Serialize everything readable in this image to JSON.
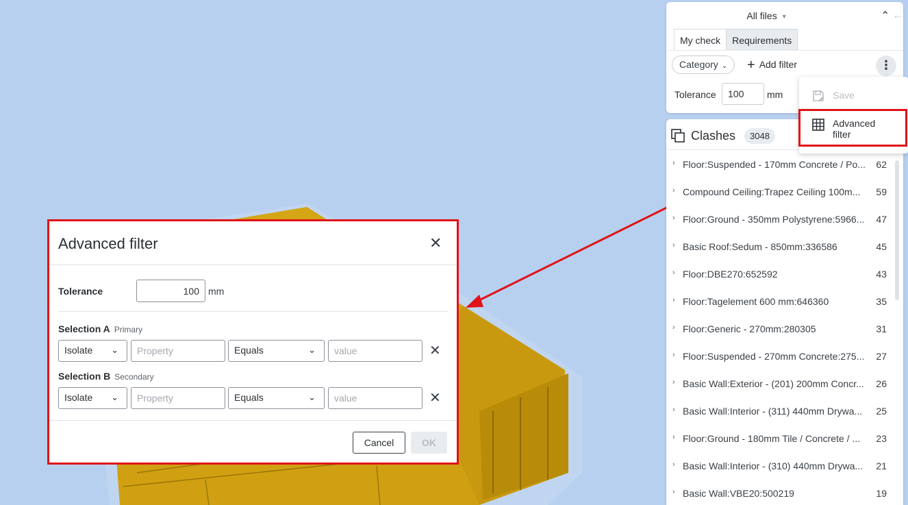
{
  "files_panel": {
    "scope_label": "All files",
    "tabs": [
      {
        "label": "My check",
        "active": true
      },
      {
        "label": "Requirements",
        "active": false
      }
    ],
    "category_label": "Category",
    "add_filter_label": "Add filter",
    "tolerance_label": "Tolerance",
    "tolerance_value": "100",
    "tolerance_unit": "mm"
  },
  "menu": {
    "save_label": "Save",
    "advanced_filter_label": "Advanced filter"
  },
  "clashes": {
    "title": "Clashes",
    "count": "3048",
    "rows": [
      {
        "name": "Floor:Suspended - 170mm Concrete / Po...",
        "count": "62"
      },
      {
        "name": "Compound Ceiling:Trapez Ceiling 100m...",
        "count": "59"
      },
      {
        "name": "Floor:Ground - 350mm Polystyrene:5966...",
        "count": "47"
      },
      {
        "name": "Basic Roof:Sedum - 850mm:336586",
        "count": "45"
      },
      {
        "name": "Floor:DBE270:652592",
        "count": "43"
      },
      {
        "name": "Floor:Tagelement 600 mm:646360",
        "count": "35"
      },
      {
        "name": "Floor:Generic - 270mm:280305",
        "count": "31"
      },
      {
        "name": "Floor:Suspended - 270mm Concrete:275...",
        "count": "27"
      },
      {
        "name": "Basic Wall:Exterior - (201) 200mm Concr...",
        "count": "26"
      },
      {
        "name": "Basic Wall:Interior - (311) 440mm Drywa...",
        "count": "25"
      },
      {
        "name": "Floor:Ground - 180mm Tile / Concrete / ...",
        "count": "23"
      },
      {
        "name": "Basic Wall:Interior - (310) 440mm Drywa...",
        "count": "21"
      },
      {
        "name": "Basic Wall:VBE20:500219",
        "count": "19"
      }
    ]
  },
  "dialog": {
    "title": "Advanced filter",
    "tolerance_label": "Tolerance",
    "tolerance_value": "100",
    "tolerance_unit": "mm",
    "selection_a": {
      "label": "Selection A",
      "sub": "Primary",
      "mode": "Isolate",
      "property_placeholder": "Property",
      "operator": "Equals",
      "value_placeholder": "value"
    },
    "selection_b": {
      "label": "Selection B",
      "sub": "Secondary",
      "mode": "Isolate",
      "property_placeholder": "Property",
      "operator": "Equals",
      "value_placeholder": "value"
    },
    "cancel_label": "Cancel",
    "ok_label": "OK"
  },
  "colors": {
    "background": "#b8d0f0",
    "model": "#d4a514",
    "highlight": "#e01218"
  }
}
